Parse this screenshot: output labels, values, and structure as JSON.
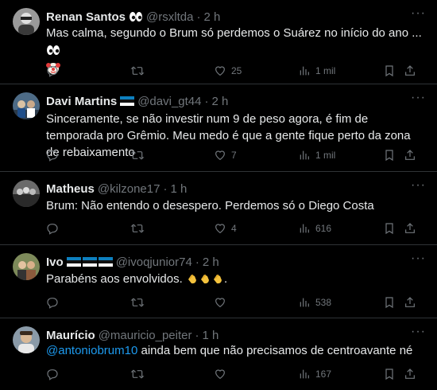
{
  "colors": {
    "background": "#000000",
    "text": "#e7e9ea",
    "muted": "#71767b",
    "link": "#1d9bf0",
    "divider": "#2f3336"
  },
  "tweets": [
    {
      "name": "Renan Santos",
      "badges": [
        "eyes-emoji"
      ],
      "handle": "@rsxltda",
      "time": "2 h",
      "text": "Mas calma, segundo o Brum só perdemos o Suárez no início do ano ...",
      "trailing_emojis": [
        "eyes-emoji",
        "clown-emoji"
      ],
      "likes": "25",
      "views": "1 mil"
    },
    {
      "name": "Davi Martins",
      "badges": [
        "gremio-flag"
      ],
      "handle": "@davi_gt44",
      "time": "2 h",
      "text": "Sinceramente, se não investir num 9 de peso agora, é fim de temporada pro Grêmio. Meu medo é que a gente fique perto da zona de rebaixamento",
      "likes": "7",
      "views": "1 mil"
    },
    {
      "name": "Matheus",
      "badges": [],
      "handle": "@kilzone17",
      "time": "1 h",
      "text": "Brum: Não entendo o desespero. Perdemos só o Diego Costa",
      "likes": "4",
      "views": "616"
    },
    {
      "name": "Ivo",
      "badges": [
        "gremio-flag",
        "gremio-flag",
        "gremio-flag"
      ],
      "handle": "@ivoqjunior74",
      "time": "2 h",
      "text": "Parabéns aos envolvidos.",
      "trailing_emojis": [
        "clapping-hands-emoji",
        "clapping-hands-emoji",
        "clapping-hands-emoji"
      ],
      "trailing_text": ".",
      "likes": "",
      "views": "538"
    },
    {
      "name": "Maurício",
      "badges": [],
      "handle": "@mauricio_peiter",
      "time": "1 h",
      "mention": "@antoniobrum10",
      "text": "ainda bem que não precisamos de centroavante né",
      "likes": "",
      "views": "167"
    }
  ],
  "separator": "·",
  "more_label": "···"
}
